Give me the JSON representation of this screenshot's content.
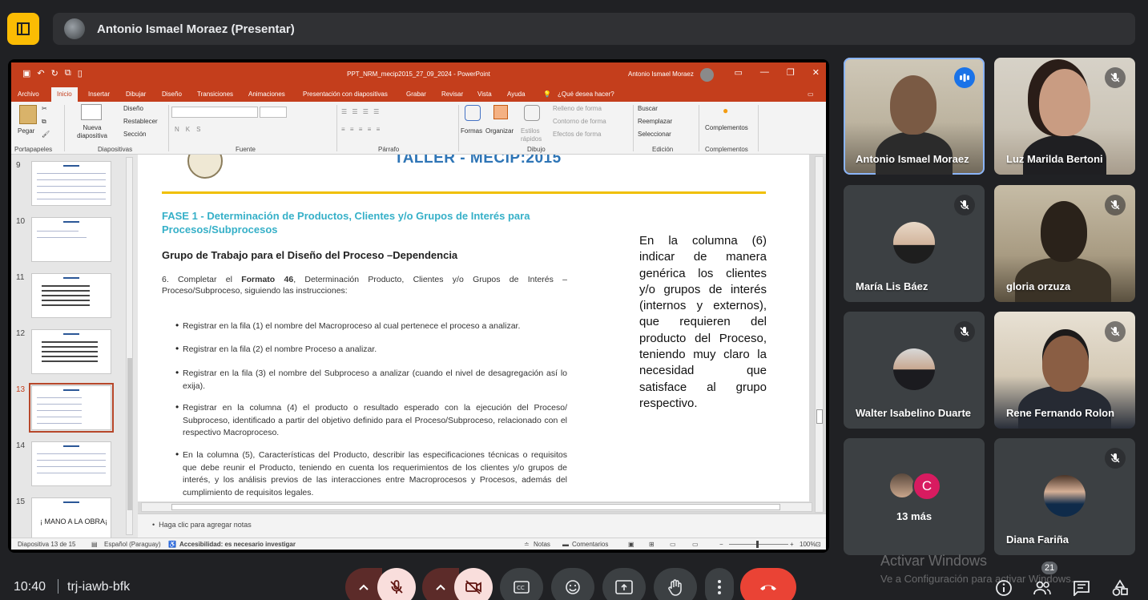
{
  "top": {
    "presenter_label": "Antonio Ismael Moraez (Presentar)"
  },
  "ppt": {
    "window_title": "PPT_NRM_mecip2015_27_09_2024 - PowerPoint",
    "user_name": "Antonio Ismael Moraez",
    "tabs": [
      "Archivo",
      "Inicio",
      "Insertar",
      "Dibujar",
      "Diseño",
      "Transiciones",
      "Animaciones",
      "Presentación con diapositivas",
      "Grabar",
      "Revisar",
      "Vista",
      "Ayuda"
    ],
    "tell_me": "¿Qué desea hacer?",
    "ribbon": {
      "paste": "Pegar",
      "new_slide": "Nueva diapositiva",
      "layout": "Diseño",
      "reset": "Restablecer",
      "section": "Sección",
      "shapes": "Formas",
      "arrange": "Organizar",
      "quick_styles": "Estilos rápidos",
      "shape_fill": "Relleno de forma",
      "shape_outline": "Contorno de forma",
      "shape_effects": "Efectos de forma",
      "find": "Buscar",
      "replace": "Reemplazar",
      "select": "Seleccionar",
      "addins": "Complementos",
      "groups": {
        "clipboard": "Portapapeles",
        "slides": "Diapositivas",
        "font": "Fuente",
        "paragraph": "Párrafo",
        "drawing": "Dibujo",
        "editing": "Edición",
        "addins": "Complementos"
      }
    },
    "thumbnails": [
      {
        "num": "9"
      },
      {
        "num": "10"
      },
      {
        "num": "11"
      },
      {
        "num": "12"
      },
      {
        "num": "13"
      },
      {
        "num": "14"
      },
      {
        "num": "15",
        "text": "¡ MANO A LA OBRA¡"
      }
    ],
    "slide": {
      "title": "TALLER - MECIP:2015",
      "phase": "FASE 1 - Determinación de Productos, Clientes y/o Grupos de Interés para          Procesos/Subprocesos",
      "group_title": "Grupo de Trabajo para el Diseño del Proceso –Dependencia",
      "item6_prefix": "6.   Completar el ",
      "item6_bold": "Formato 46",
      "item6_suffix": ", Determinación Producto, Clientes y/o Grupos de Interés – Proceso/Subproceso, siguiendo las instrucciones:",
      "bullets": [
        "Registrar en la fila (1) el nombre del Macroproceso al cual pertenece el proceso a analizar.",
        "Registrar en la fila (2) el nombre Proceso a analizar.",
        "Registrar en la fila (3) el nombre del Subproceso a analizar (cuando el nivel de desagregación así lo exija).",
        "Registrar en la columna (4) el producto o resultado esperado con la ejecución del Proceso/ Subproceso, identificado a partir del objetivo definido para el Proceso/Subproceso, relacionado con el respectivo Macroproceso.",
        "En la columna (5), Características del Producto, describir las especificaciones técnicas o requisitos que debe reunir el Producto, teniendo en cuenta los requerimientos de los clientes y/o grupos de interés, y los análisis previos de las interacciones entre Macroprocesos y Procesos, además del cumplimiento de requisitos legales."
      ],
      "side_text": "En la columna (6) indicar de manera genérica los clientes y/o grupos de interés (internos y externos), que requieren del producto del Proceso, teniendo muy claro la necesidad que satisface al grupo respectivo."
    },
    "notes_placeholder": "Haga clic para agregar notas",
    "status": {
      "slide_count": "Diapositiva 13 de 15",
      "language": "Español (Paraguay)",
      "accessibility": "Accesibilidad: es necesario investigar",
      "notes": "Notas",
      "comments": "Comentarios",
      "zoom": "100%"
    }
  },
  "participants": [
    {
      "name": "Antonio Ismael Moraez",
      "mic": "active"
    },
    {
      "name": "Luz Marilda Bertoni",
      "mic": "muted"
    },
    {
      "name": "María Lis Báez",
      "mic": "muted"
    },
    {
      "name": "gloria orzuza",
      "mic": "muted"
    },
    {
      "name": "Walter Isabelino Duarte",
      "mic": "muted"
    },
    {
      "name": "Rene Fernando Rolon",
      "mic": "muted"
    },
    {
      "name": "Diana Fariña",
      "mic": "muted"
    }
  ],
  "more": {
    "label": "13 más",
    "initial": "C"
  },
  "watermark": {
    "line1": "Activar Windows",
    "line2": "Ve a Configuración para activar Windows."
  },
  "bottom": {
    "time": "10:40",
    "meeting_code": "trj-iawb-bfk",
    "participants_count": "21"
  },
  "colors": {
    "ppt_accent": "#c43e1c",
    "meet_end_call": "#ea4335",
    "meet_active_mic": "#1a73e8"
  }
}
